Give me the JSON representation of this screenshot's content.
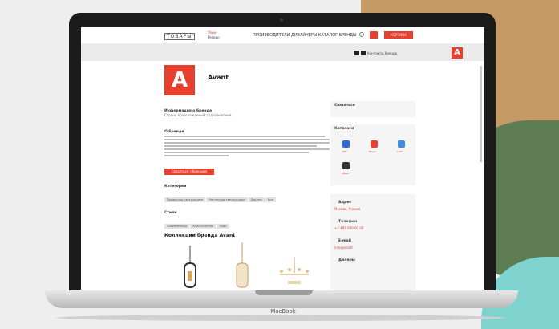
{
  "laptop": {
    "brand": "MacBook"
  },
  "site": {
    "logo": "ТОВАРЫ",
    "lang": [
      "Язык",
      "Регион"
    ],
    "menu": "ПРОИЗВОДИТЕЛИ  ДИЗАЙНЕРЫ  КАТАЛОГ  БРЕНДЫ",
    "menu_highlight": "БРЕНДЫ",
    "cart_label": "КОРЗИНА",
    "greybar_text": "Контакты бренда"
  },
  "product": {
    "name": "Avant",
    "logo_letter": "A",
    "intro_heading": "Информация о бренде",
    "intro_text": "Страна происхождения, год основания",
    "about_heading": "О бренде",
    "cta_label": "Связаться с брендом",
    "categories_heading": "Категории",
    "categories": [
      "Подвесные светильники",
      "Настенные светильники",
      "Люстры",
      "Бра"
    ],
    "styles_heading": "Стили",
    "styles": [
      "Современный",
      "Классический",
      "Лофт"
    ],
    "collection_title": "Коллекции бренда Avant"
  },
  "sidebar": {
    "box1": "Связаться",
    "box2": "Каталоги",
    "icon_labels": [
      "PDF",
      "Видео",
      "Сайт",
      "Прайс"
    ],
    "box3_heading": "Адрес",
    "box3_link": "Москва, Россия",
    "box4_heading": "Телефон",
    "box4_link": "+7 495 000 00 00",
    "box5_heading": "E-mail",
    "box5_link": "info@avant",
    "box6_heading": "Дилеры"
  }
}
